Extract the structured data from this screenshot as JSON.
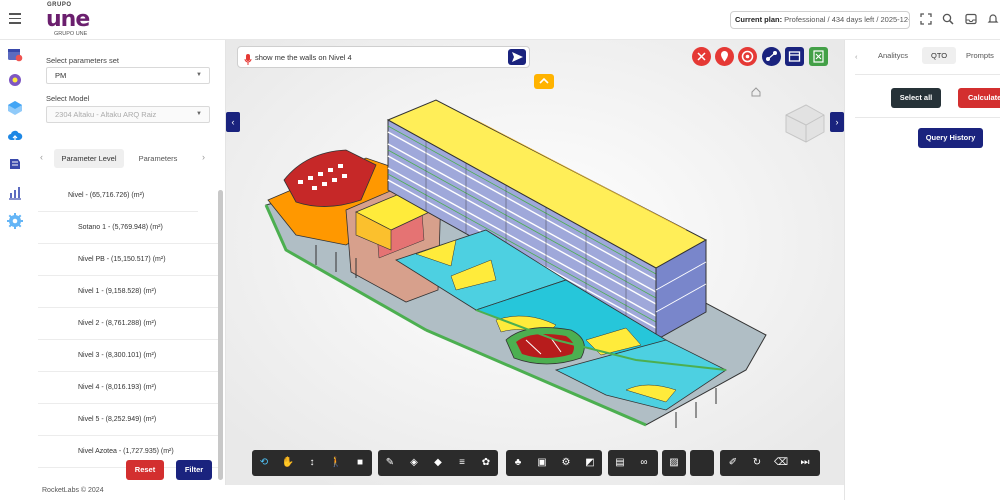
{
  "header": {
    "logo_top": "GRUPO",
    "logo_main": "une",
    "logo_sub": "GRUPO UNE",
    "plan_label": "Current plan:",
    "plan_detail": " Professional / 434 days left / 2025-12-31"
  },
  "left_panel": {
    "params_set_label": "Select parameters set",
    "params_set_value": "PM",
    "model_label": "Select Model",
    "model_value": "2304 Altaku - Altaku ARQ Raiz",
    "tabs": [
      "Parameter Level",
      "Parameters"
    ],
    "items": [
      "Nivel - (65,716.726) (m²)",
      "Sotano 1 - (5,769.948) (m²)",
      "Nivel PB - (15,150.517) (m²)",
      "Nivel 1 - (9,158.528) (m²)",
      "Nivel 2 - (8,761.288) (m²)",
      "Nivel 3 - (8,300.101) (m²)",
      "Nivel 4 - (8,016.193) (m²)",
      "Nivel 5 - (8,252.949) (m²)",
      "Nivel Azotea - (1,727.935) (m²)"
    ],
    "reset_label": "Reset",
    "filter_label": "Filter"
  },
  "viewer": {
    "query_text": "show me the walls on Nivel 4"
  },
  "right_panel": {
    "tabs": [
      "Analitycs",
      "QTO",
      "Prompts"
    ],
    "select_all_label": "Select all",
    "calculate_label": "Calculate",
    "history_label": "Query History"
  },
  "footer": {
    "copyright": "RocketLabs © 2024"
  },
  "colors": {
    "navy": "#1a237e",
    "red": "#d32f2f",
    "yellow": "#ffeb3b",
    "cyan": "#4dd0e1",
    "accent_magenta": "#6b1f6e"
  }
}
